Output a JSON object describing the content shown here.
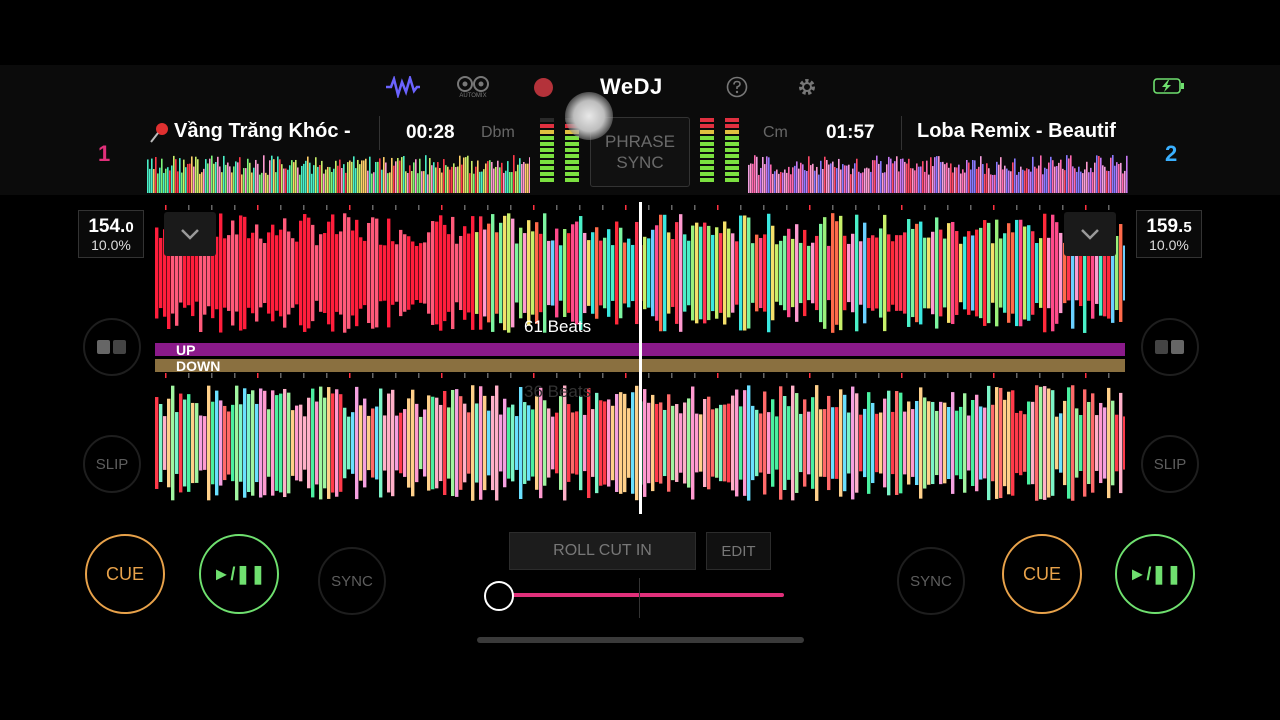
{
  "app": {
    "brand": "WeDJ",
    "automix_label": "AUTOMIX"
  },
  "colors": {
    "pink": "#e0307a",
    "blue": "#3ab0ff",
    "cue": "#e8a24a",
    "play": "#6fe06f",
    "up_band": "#8a1a8a",
    "down_band": "#8a7040"
  },
  "icons": [
    "waveform-icon",
    "automix-icon",
    "record-icon",
    "help-icon",
    "gear-icon",
    "battery-charging-icon"
  ],
  "deck1": {
    "number": "1",
    "title": "Vầng Trăng Khóc -",
    "time": "00:28",
    "key": "Dbm",
    "bpm_main": "154.",
    "bpm_dec": "0",
    "pitch": "10.0%",
    "slip": "SLIP",
    "cue": "CUE",
    "play": "►/❚❚",
    "sync": "SYNC"
  },
  "deck2": {
    "number": "2",
    "title": "Loba Remix - Beautif",
    "time": "01:57",
    "key": "Cm",
    "bpm_main": "159.",
    "bpm_dec": "5",
    "pitch": "10.0%",
    "slip": "SLIP",
    "cue": "CUE",
    "play": "►/❚❚",
    "sync": "SYNC"
  },
  "center": {
    "phrase_line1": "PHRASE",
    "phrase_line2": "SYNC",
    "beats_top": "61 Beats",
    "beats_bottom": "36 Beats",
    "up_label": "UP",
    "down_label": "DOWN",
    "roll_label": "ROLL CUT IN",
    "edit_label": "EDIT",
    "crossfader": 0.0
  }
}
